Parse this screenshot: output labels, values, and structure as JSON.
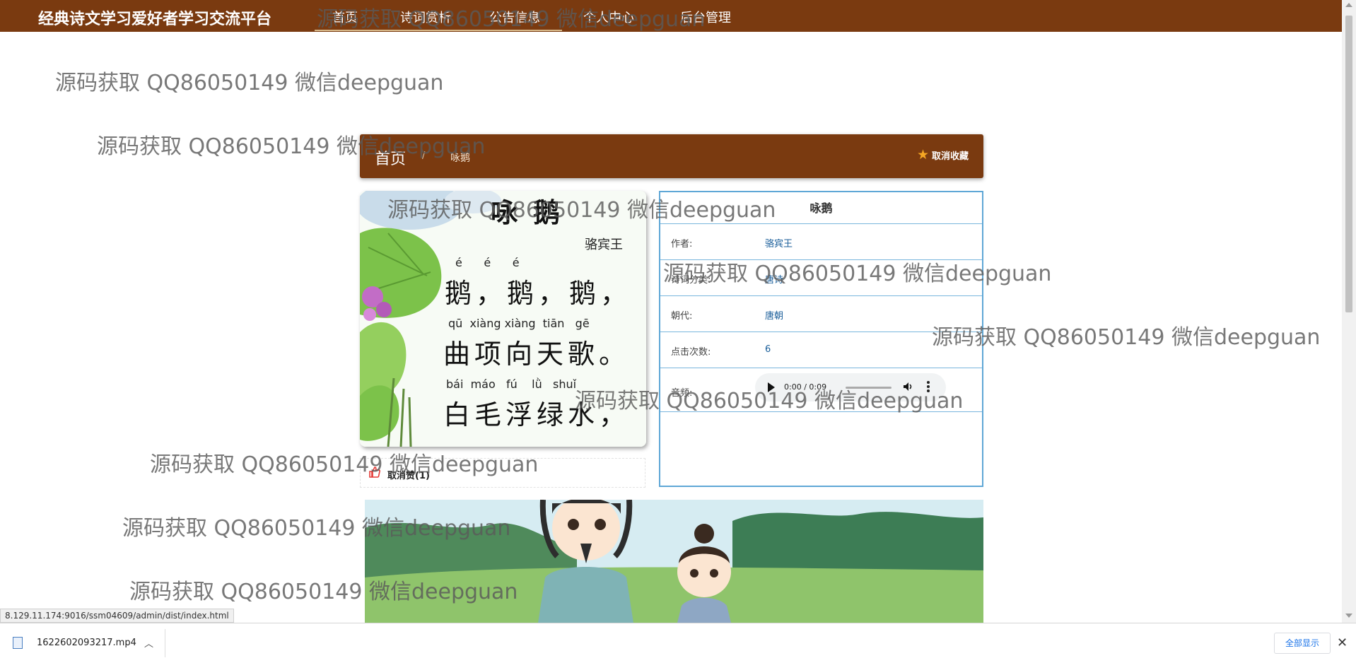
{
  "header": {
    "brand": "经典诗文学习爱好者学习交流平台",
    "nav": [
      "首页",
      "诗词赏析",
      "公告信息",
      "个人中心",
      "后台管理"
    ]
  },
  "watermark": "源码获取 QQ86050149 微信deepguan",
  "breadcrumb": {
    "home": "首页",
    "separator": "/",
    "current": "咏鹅"
  },
  "favorite_button": "取消收藏",
  "poem_image": {
    "title": "咏鹅",
    "author": "骆宾王",
    "lines": [
      {
        "pinyin": "é      é      é",
        "text": "鹅，鹅，鹅，"
      },
      {
        "pinyin": "qū  xiàng xiàng  tiān   gē",
        "text": "曲项向天歌。"
      },
      {
        "pinyin": "bái  máo   fú    lǜ   shuǐ",
        "text": "白毛浮绿水，"
      }
    ]
  },
  "like_button": "取消赞(1)",
  "detail": {
    "title": "咏鹅",
    "rows": [
      {
        "label": "作者:",
        "value": "骆宾王"
      },
      {
        "label": "诗词分类:",
        "value": "唐诗"
      },
      {
        "label": "朝代:",
        "value": "唐朝"
      },
      {
        "label": "点击次数:",
        "value": "6"
      },
      {
        "label": "音频:",
        "value": ""
      }
    ],
    "audio_time": "0:00 / 0:09"
  },
  "status_url": "8.129.11.174:9016/ssm04609/admin/dist/index.html",
  "download": {
    "filename": "1622602093217.mp4",
    "show_all": "全部显示"
  },
  "colors": {
    "brand_brown": "#7a3a10",
    "link_blue": "#1a5e9a",
    "border_blue": "#5fa7d6",
    "star": "#f5a623",
    "like_red": "#e53935"
  }
}
